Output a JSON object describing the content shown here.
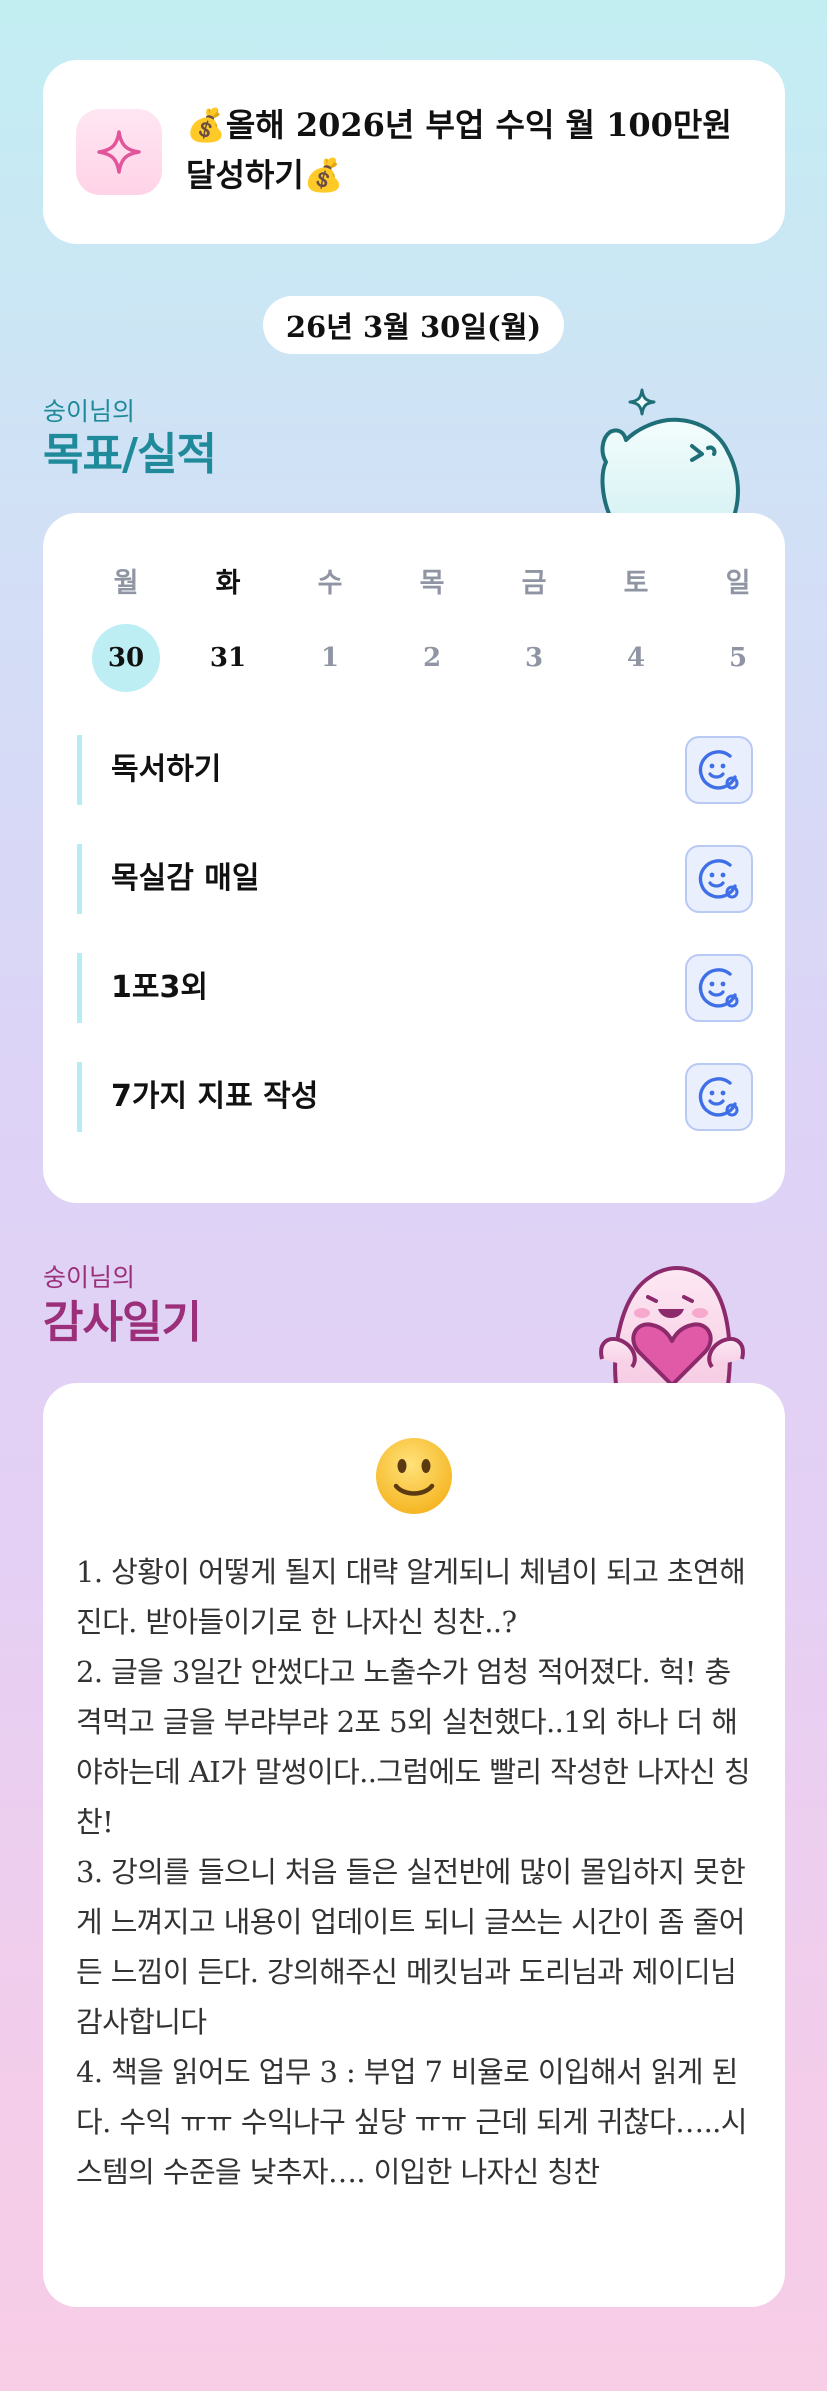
{
  "goal": {
    "text": "💰올해 2026년 부업 수익 월 100만원 달성하기💰",
    "icon": "sparkle-icon"
  },
  "date": "26년 3월 30일(월)",
  "goals_section": {
    "subtitle": "숭이님의",
    "title": "목표/실적"
  },
  "calendar": {
    "weekdays": [
      "월",
      "화",
      "수",
      "목",
      "금",
      "토",
      "일"
    ],
    "dates": [
      "30",
      "31",
      "1",
      "2",
      "3",
      "4",
      "5"
    ]
  },
  "tasks": [
    {
      "label": "독서하기",
      "icon": "smiley-check-icon"
    },
    {
      "label": "목실감 매일",
      "icon": "smiley-check-icon"
    },
    {
      "label": "1포3외",
      "icon": "smiley-check-icon"
    },
    {
      "label": "7가지 지표 작성",
      "icon": "smiley-check-icon"
    }
  ],
  "gratitude_section": {
    "subtitle": "숭이님의",
    "title": "감사일기"
  },
  "gratitude": {
    "emoji": "slightly-smiling-face-icon",
    "text": "1. 상황이 어떻게 될지 대략 알게되니 체념이 되고 초연해진다. 받아들이기로 한 나자신 칭찬..?\n2. 글을 3일간 안썼다고 노출수가 엄청 적어졌다. 헉! 충격먹고 글을 부랴부랴 2포 5외 실천했다..1외 하나 더 해야하는데 AI가 말썽이다..그럼에도 빨리 작성한 나자신 칭찬!\n3. 강의를 들으니 처음 들은 실전반에 많이 몰입하지 못한게 느껴지고 내용이 업데이트 되니 글쓰는 시간이 좀 줄어든 느낌이 든다. 강의해주신 메킷님과 도리님과 제이디님 감사합니다\n4. 책을 읽어도 업무 3 : 부업 7 비율로 이입해서 읽게 된다. 수익 ㅠㅠ 수익나구 싶당 ㅠㅠ 근데 되게 귀찮다…..시스템의 수준을 낮추자…. 이입한 나자신 칭찬"
  },
  "colors": {
    "accent_teal": "#1f8a9a",
    "accent_magenta": "#9b2f7a",
    "today_highlight": "#bdeef3",
    "task_bar": "#b5eef2",
    "icon_blue": "#3f6fe6"
  }
}
